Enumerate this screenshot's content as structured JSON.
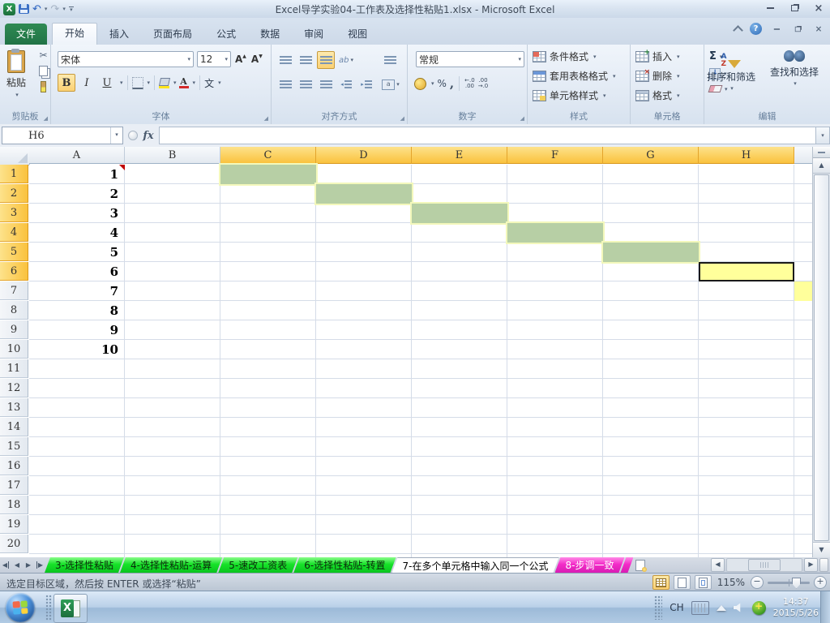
{
  "window": {
    "title": "Excel导学实验04-工作表及选择性粘贴1.xlsx -  Microsoft Excel"
  },
  "ribbon": {
    "tabs": [
      {
        "label": "文件"
      },
      {
        "label": "开始"
      },
      {
        "label": "插入"
      },
      {
        "label": "页面布局"
      },
      {
        "label": "公式"
      },
      {
        "label": "数据"
      },
      {
        "label": "审阅"
      },
      {
        "label": "视图"
      }
    ],
    "clipboard": {
      "paste": "粘贴",
      "label": "剪贴板"
    },
    "font": {
      "name": "宋体",
      "size": "12",
      "label": "字体"
    },
    "alignment": {
      "label": "对齐方式"
    },
    "number": {
      "format": "常规",
      "label": "数字"
    },
    "styles": {
      "items": [
        "条件格式",
        "套用表格格式",
        "单元格样式"
      ],
      "label": "样式"
    },
    "cells_group": {
      "items": [
        "插入",
        "删除",
        "格式"
      ],
      "label": "单元格"
    },
    "editing": {
      "sort": "排序和筛选",
      "find": "查找和选择",
      "label": "编辑"
    }
  },
  "formula_bar": {
    "name_box": "H6",
    "fx": "fx",
    "value": ""
  },
  "grid": {
    "columns": [
      "A",
      "B",
      "C",
      "D",
      "E",
      "F",
      "G",
      "H"
    ],
    "selected_columns": [
      "C",
      "D",
      "E",
      "F",
      "G",
      "H"
    ],
    "row_count": 20,
    "selected_rows": [
      1,
      2,
      3,
      4,
      5,
      6
    ],
    "column_a_values": [
      "1",
      "2",
      "3",
      "4",
      "5",
      "6",
      "7",
      "8",
      "9",
      "10"
    ],
    "green_cells": [
      "C1",
      "D2",
      "E3",
      "F4",
      "G5"
    ],
    "yellow_cells": [
      "H6",
      "I7"
    ],
    "active_cell": "H6",
    "comment_cell": "A1"
  },
  "sheet_tabs": {
    "items": [
      {
        "label": "3-选择性粘贴",
        "color": "green"
      },
      {
        "label": "4-选择性粘贴-运算",
        "color": "green"
      },
      {
        "label": "5-速改工资表",
        "color": "green"
      },
      {
        "label": "6-选择性粘贴-转置",
        "color": "green"
      },
      {
        "label": "7-在多个单元格中输入同一个公式",
        "color": "active"
      },
      {
        "label": "8-步调一致",
        "color": "magenta"
      }
    ]
  },
  "status_bar": {
    "message": "选定目标区域，然后按 ENTER 或选择“粘贴”",
    "zoom": "115%"
  },
  "taskbar": {
    "lang": "CH",
    "time": "14:37",
    "date": "2015/5/26"
  },
  "colors": {
    "cell_green": "#b7cfa5",
    "cell_yellow": "#ffff9b",
    "gold_header": "#fac23e",
    "tab_green": "#17e229",
    "tab_magenta": "#f32cc8",
    "file_tab_green": "#217346"
  }
}
